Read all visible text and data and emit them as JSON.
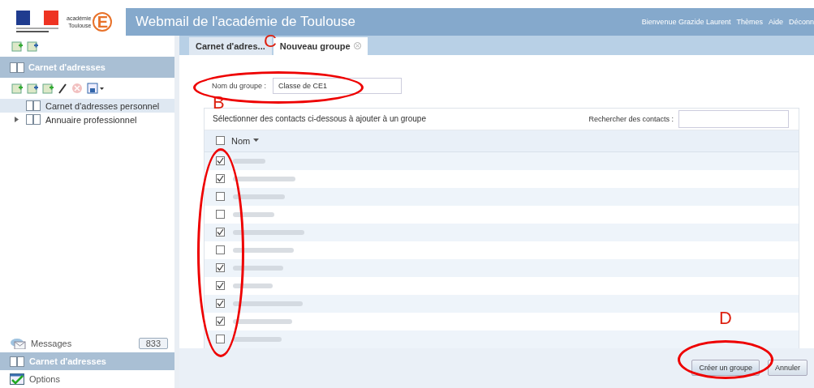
{
  "header": {
    "logo_text": [
      "académie",
      "Toulouse"
    ],
    "logo_letter": "E",
    "title": "Webmail de l'académie de Toulouse",
    "links": [
      "Bienvenue Grazide Laurent",
      "Thèmes",
      "Aide",
      "Déconn"
    ]
  },
  "sidebar": {
    "section_title": "Carnet d'adresses",
    "tree": [
      {
        "label": "Carnet d'adresses personnel",
        "selected": true,
        "expandable": false
      },
      {
        "label": "Annuaire professionnel",
        "selected": false,
        "expandable": true
      }
    ],
    "nav": [
      {
        "label": "Messages",
        "badge": "833",
        "selected": false,
        "kind": "mail"
      },
      {
        "label": "Carnet d'adresses",
        "selected": true,
        "kind": "book"
      },
      {
        "label": "Options",
        "selected": false,
        "kind": "check"
      }
    ]
  },
  "tabs": [
    {
      "label": "Carnet d'adres...",
      "selected": false,
      "closable": false
    },
    {
      "label": "Nouveau groupe",
      "selected": true,
      "closable": true
    }
  ],
  "group_name": {
    "label": "Nom du groupe :",
    "value": "Classe de CE1"
  },
  "contacts": {
    "instruction": "Sélectionner des contacts ci-dessous à ajouter à un groupe",
    "search_label": "Rechercher des contacts :",
    "column": "Nom",
    "all_checked": false,
    "rows": [
      {
        "checked": true
      },
      {
        "checked": true
      },
      {
        "checked": false
      },
      {
        "checked": false
      },
      {
        "checked": true
      },
      {
        "checked": false
      },
      {
        "checked": true
      },
      {
        "checked": true
      },
      {
        "checked": true
      },
      {
        "checked": true
      },
      {
        "checked": false
      }
    ]
  },
  "buttons": [
    "Créer un groupe",
    "Annuler"
  ],
  "annotations": [
    {
      "label": "B"
    },
    {
      "label": "C"
    },
    {
      "label": "D"
    }
  ]
}
